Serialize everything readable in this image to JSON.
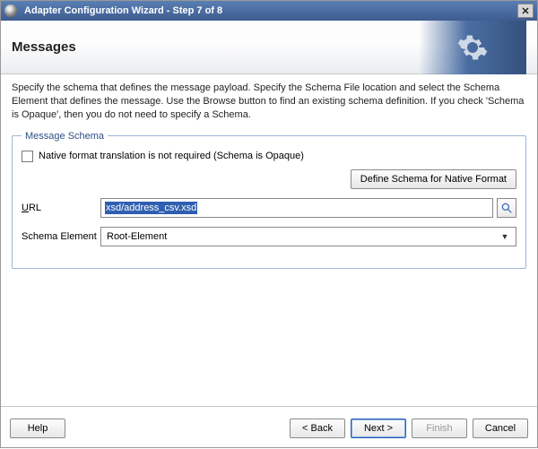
{
  "titlebar": {
    "title": "Adapter Configuration Wizard - Step 7 of 8"
  },
  "header": {
    "heading": "Messages"
  },
  "instructions": "Specify the schema that defines the message payload.  Specify the Schema File location and select the Schema Element that defines the message. Use the Browse button to find an existing schema definition. If you check 'Schema is Opaque', then you do not need to specify a Schema.",
  "schema": {
    "legend": "Message Schema",
    "opaque_label": "Native format translation is not required (Schema is Opaque)",
    "opaque_checked": false,
    "define_btn": "Define Schema for Native Format",
    "url_label_pre": "U",
    "url_label_rest": "RL",
    "url_value": "xsd/address_csv.xsd",
    "element_label": "Schema Element",
    "element_value": "Root-Element"
  },
  "footer": {
    "help": "Help",
    "back": "< Back",
    "next": "Next >",
    "finish": "Finish",
    "cancel": "Cancel"
  }
}
